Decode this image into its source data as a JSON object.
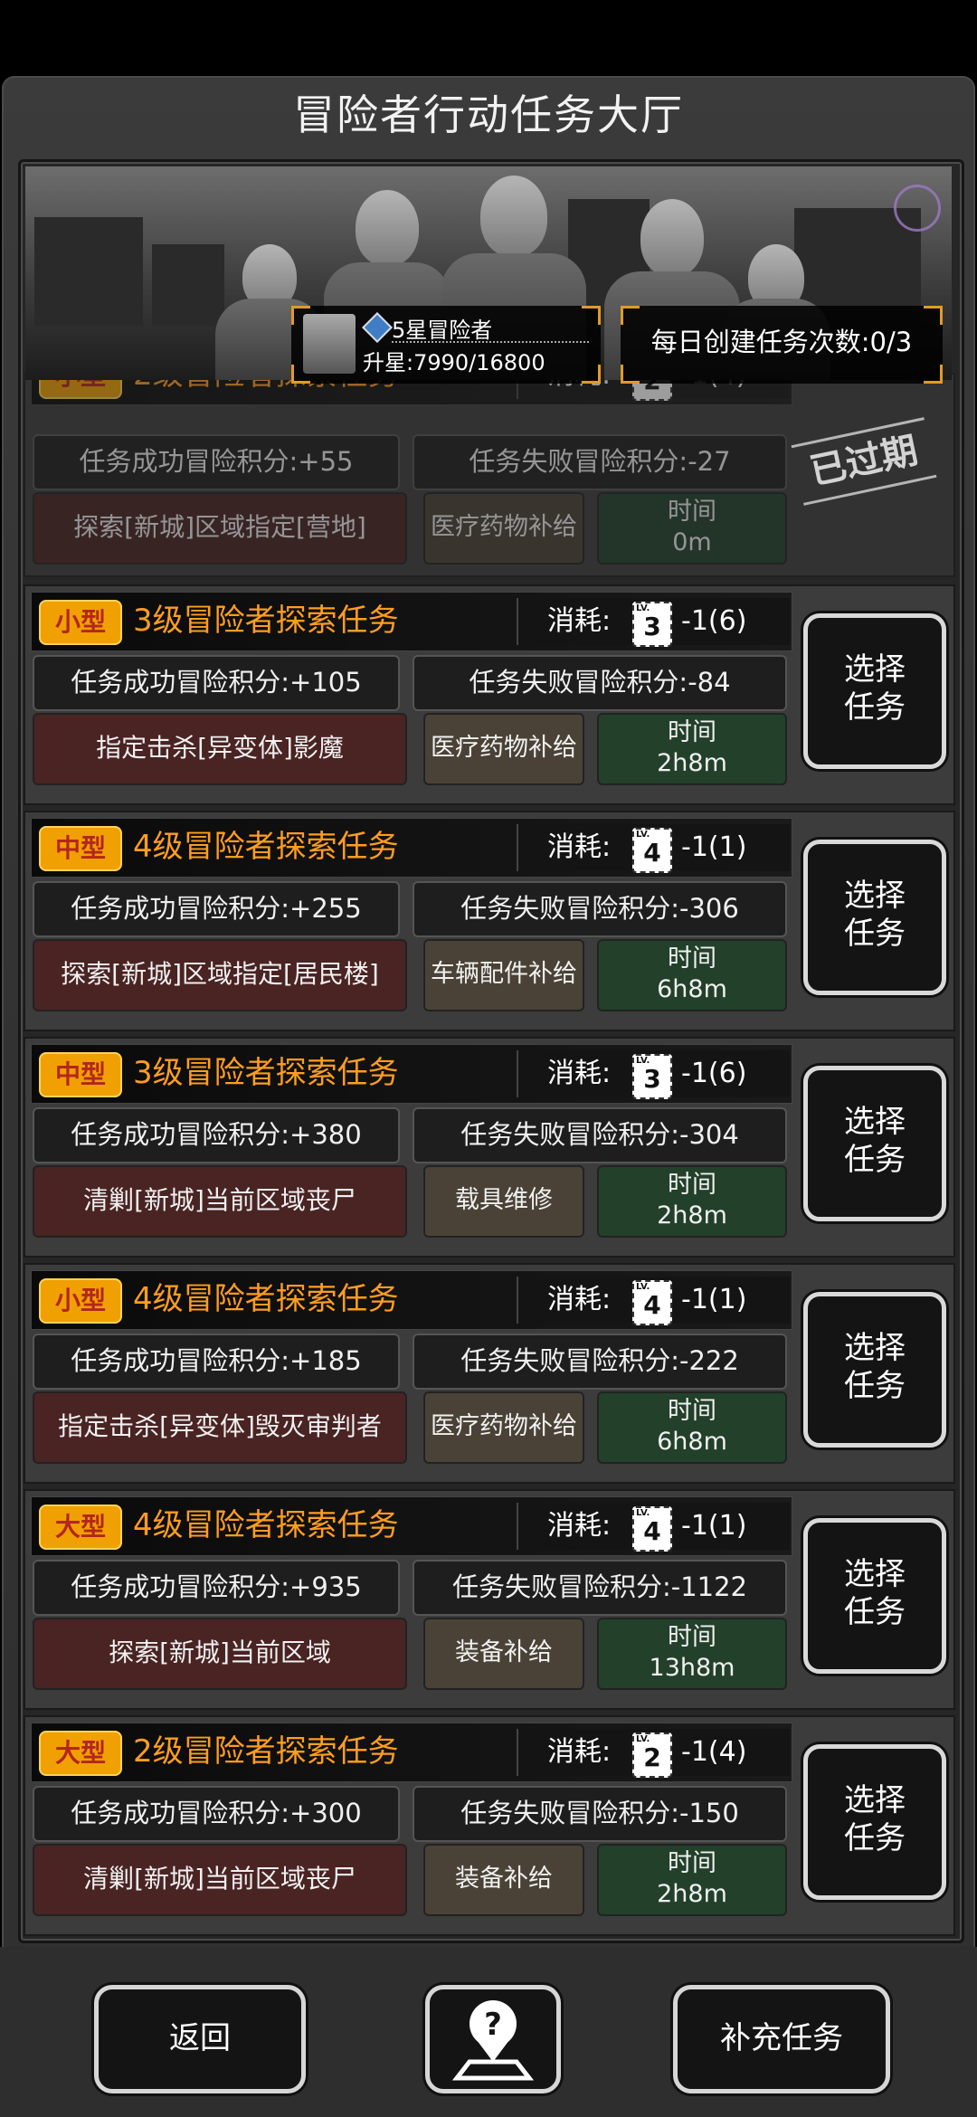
{
  "title": "冒险者行动任务大厅",
  "rank": {
    "name": "5星冒险者",
    "progress": "升星:7990/16800"
  },
  "daily": "每日创建任务次数:0/3",
  "cost_label": "消耗:",
  "select_label_1": "选择",
  "select_label_2": "任务",
  "time_label": "时间",
  "expired": {
    "size": "小型",
    "title": "2级冒险者探索任务",
    "cost_level": "2",
    "cost_value": "-1(4)",
    "success": "任务成功冒险积分:+55",
    "fail": "任务失败冒险积分:-27",
    "target": "探索[新城]区域指定[营地]",
    "reward": "医疗药物补给",
    "time": "0m",
    "stamp": "已过期"
  },
  "tasks": [
    {
      "size": "小型",
      "title": "3级冒险者探索任务",
      "cost_level": "3",
      "cost_value": "-1(6)",
      "success": "任务成功冒险积分:+105",
      "fail": "任务失败冒险积分:-84",
      "target": "指定击杀[异变体]影魔",
      "reward": "医疗药物补给",
      "time": "2h8m"
    },
    {
      "size": "中型",
      "title": "4级冒险者探索任务",
      "cost_level": "4",
      "cost_value": "-1(1)",
      "success": "任务成功冒险积分:+255",
      "fail": "任务失败冒险积分:-306",
      "target": "探索[新城]区域指定[居民楼]",
      "reward": "车辆配件补给",
      "time": "6h8m"
    },
    {
      "size": "中型",
      "title": "3级冒险者探索任务",
      "cost_level": "3",
      "cost_value": "-1(6)",
      "success": "任务成功冒险积分:+380",
      "fail": "任务失败冒险积分:-304",
      "target": "清剿[新城]当前区域丧尸",
      "reward": "载具维修",
      "time": "2h8m"
    },
    {
      "size": "小型",
      "title": "4级冒险者探索任务",
      "cost_level": "4",
      "cost_value": "-1(1)",
      "success": "任务成功冒险积分:+185",
      "fail": "任务失败冒险积分:-222",
      "target": "指定击杀[异变体]毁灭审判者",
      "reward": "医疗药物补给",
      "time": "6h8m"
    },
    {
      "size": "大型",
      "title": "4级冒险者探索任务",
      "cost_level": "4",
      "cost_value": "-1(1)",
      "success": "任务成功冒险积分:+935",
      "fail": "任务失败冒险积分:-1122",
      "target": "探索[新城]当前区域",
      "reward": "装备补给",
      "time": "13h8m"
    },
    {
      "size": "大型",
      "title": "2级冒险者探索任务",
      "cost_level": "2",
      "cost_value": "-1(4)",
      "success": "任务成功冒险积分:+300",
      "fail": "任务失败冒险积分:-150",
      "target": "清剿[新城]当前区域丧尸",
      "reward": "装备补给",
      "time": "2h8m"
    }
  ],
  "buttons": {
    "back": "返回",
    "add": "补充任务"
  },
  "colors": {
    "size_small_text": "#b3261e",
    "size_tag_bg": "#f0a000",
    "title_orange": "#ff9d1f",
    "target_bg": "#4a2323",
    "reward_bg": "#4a4236",
    "time_bg": "#22402a"
  },
  "icons": {
    "help": "help-map-pin-icon",
    "level_ticket": "level-ticket-icon"
  }
}
